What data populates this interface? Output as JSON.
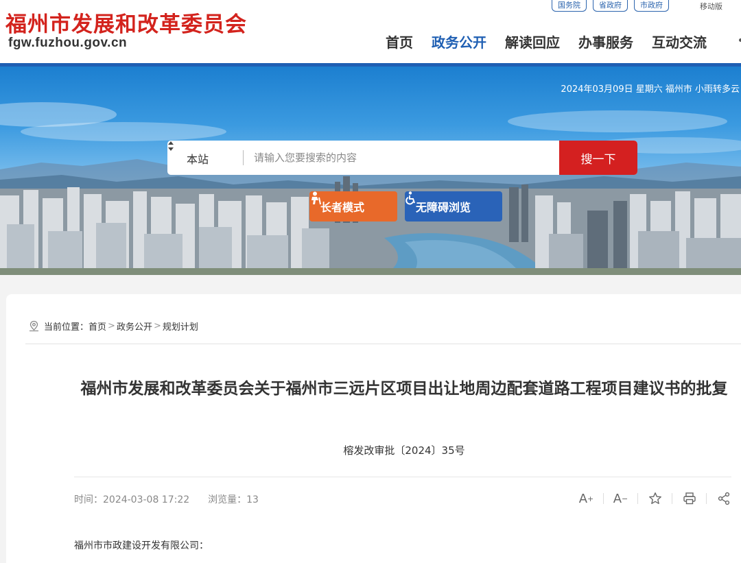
{
  "header": {
    "site_title": "福州市发展和改革委员会",
    "domain": "fgw.fuzhou.gov.cn",
    "top_links": [
      "国务院",
      "省政府",
      "市政府"
    ],
    "mobile_label": "移动版",
    "nav": [
      "首页",
      "政务公开",
      "解读回应",
      "办事服务",
      "互动交流"
    ],
    "active_nav": "政务公开",
    "brand_color": "#d3231d",
    "accent_color": "#1f5fb3"
  },
  "banner": {
    "date_weather": "2024年03月09日 星期六 福州市 小雨转多云",
    "search": {
      "scope": "本站",
      "placeholder": "请输入您要搜索的内容",
      "button": "搜一下"
    },
    "elder_mode": "长者模式",
    "accessible_mode": "无障碍浏览"
  },
  "breadcrumb": {
    "prefix": "当前位置：",
    "items": [
      "首页",
      "政务公开",
      "规划计划"
    ]
  },
  "article": {
    "title": "福州市发展和改革委员会关于福州市三远片区项目出让地周边配套道路工程项目建议书的批复",
    "doc_number": "榕发改审批〔2024〕35号",
    "time_label": "时间：",
    "time": "2024-03-08 17:22",
    "views_label": "浏览量：",
    "views": "13",
    "tools": [
      "A+",
      "A-"
    ],
    "body_first_line": "福州市市政建设开发有限公司："
  }
}
